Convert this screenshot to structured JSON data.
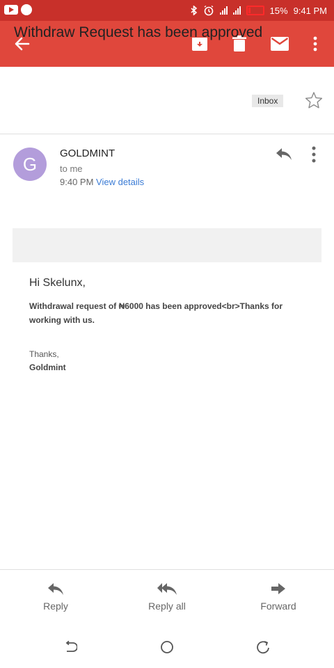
{
  "status_bar": {
    "battery": "15%",
    "time": "9:41 PM"
  },
  "email": {
    "subject": "Withdraw Request has been approved",
    "label": "Inbox",
    "sender_initial": "G",
    "sender_name": "GOLDMINT",
    "recipient": "to me",
    "time": "9:40 PM",
    "view_details": "View details",
    "greeting": "Hi Skelunx,",
    "body": "Withdrawal request of ₦6000 has been approved<br>Thanks for working with us.",
    "closing": "Thanks,",
    "signature": "Goldmint"
  },
  "actions": {
    "reply": "Reply",
    "reply_all": "Reply all",
    "forward": "Forward"
  },
  "colors": {
    "app_bar": "#e0473c",
    "status_bar": "#c8302a",
    "avatar": "#b39ddb",
    "link": "#3a7bd5"
  }
}
